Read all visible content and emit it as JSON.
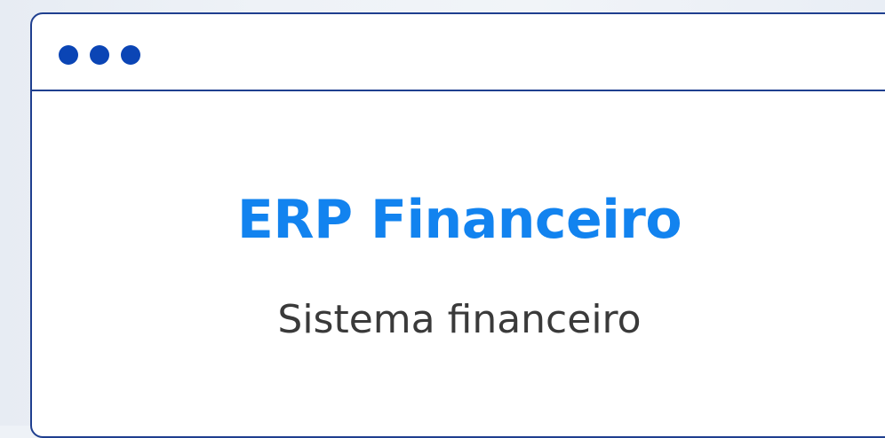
{
  "window": {
    "title": "ERP Financeiro",
    "subtitle": "Sistema financeiro",
    "controls": [
      {
        "icon": "window-dot-icon"
      },
      {
        "icon": "window-dot-icon"
      },
      {
        "icon": "window-dot-icon"
      }
    ]
  },
  "colors": {
    "accent": "#1283ef",
    "border": "#1f3f8f",
    "dot": "#0b45b5",
    "text": "#3a3a3a"
  }
}
